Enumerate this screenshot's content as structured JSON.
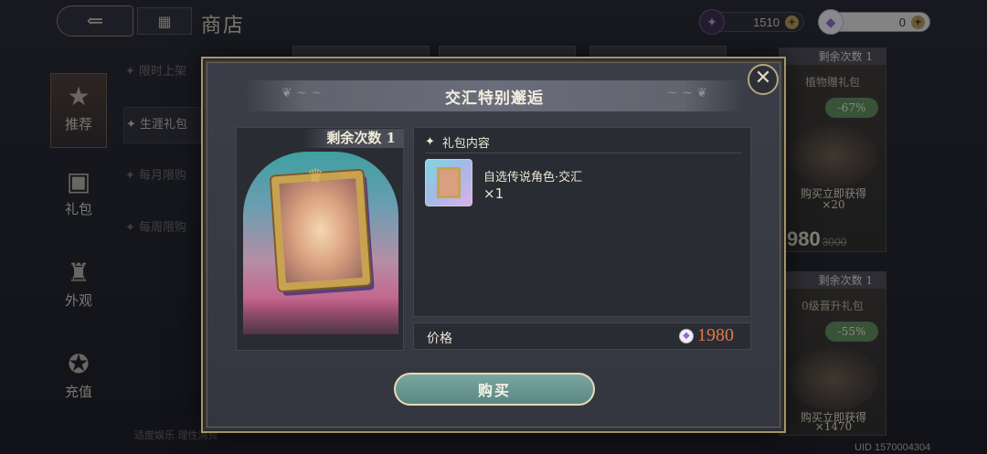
{
  "header": {
    "title": "商店",
    "back_icon": "back-arrow-icon",
    "home_icon": "home-grid-icon",
    "currencies": [
      {
        "icon": "star-gem-icon",
        "value": "1510",
        "plus": "+"
      },
      {
        "icon": "crystal-icon",
        "value": "0",
        "plus": "+"
      }
    ]
  },
  "sidebar": {
    "items": [
      {
        "label": "推荐",
        "icon": "star-banner-icon",
        "active": true
      },
      {
        "label": "礼包",
        "icon": "gift-box-icon",
        "active": false
      },
      {
        "label": "外观",
        "icon": "outfit-icon",
        "active": false
      },
      {
        "label": "充值",
        "icon": "star-badge-icon",
        "active": false
      }
    ]
  },
  "subnav": {
    "items": [
      {
        "label": "✦ 限时上架",
        "active": false
      },
      {
        "label": "✦ 生涯礼包",
        "active": true
      },
      {
        "label": "✦ 每月限购",
        "active": false
      },
      {
        "label": "✦ 每周限购",
        "active": false
      }
    ]
  },
  "right_cards": [
    {
      "head": "剩余次数 1",
      "name": "植物赠礼包",
      "discount": "-67%",
      "gain": "购买立即获得",
      "count": "×20",
      "price": "980",
      "old_price": "3000"
    },
    {
      "head": "剩余次数 1",
      "name": "0级晋升礼包",
      "discount": "-55%",
      "gain": "购买立即获得",
      "count": "×1470"
    }
  ],
  "bottom_note": "适度娱乐 理性消费",
  "uid": "UID 1570004304",
  "modal": {
    "title": "交汇特别邂逅",
    "close_label": "✕",
    "remaining": "剩余次数 1",
    "contents_heading": "礼包内容",
    "item": {
      "name": "自选传说角色·交汇",
      "qty": "×1"
    },
    "price_label": "价格",
    "price": "1980",
    "buy_label": "购买"
  }
}
